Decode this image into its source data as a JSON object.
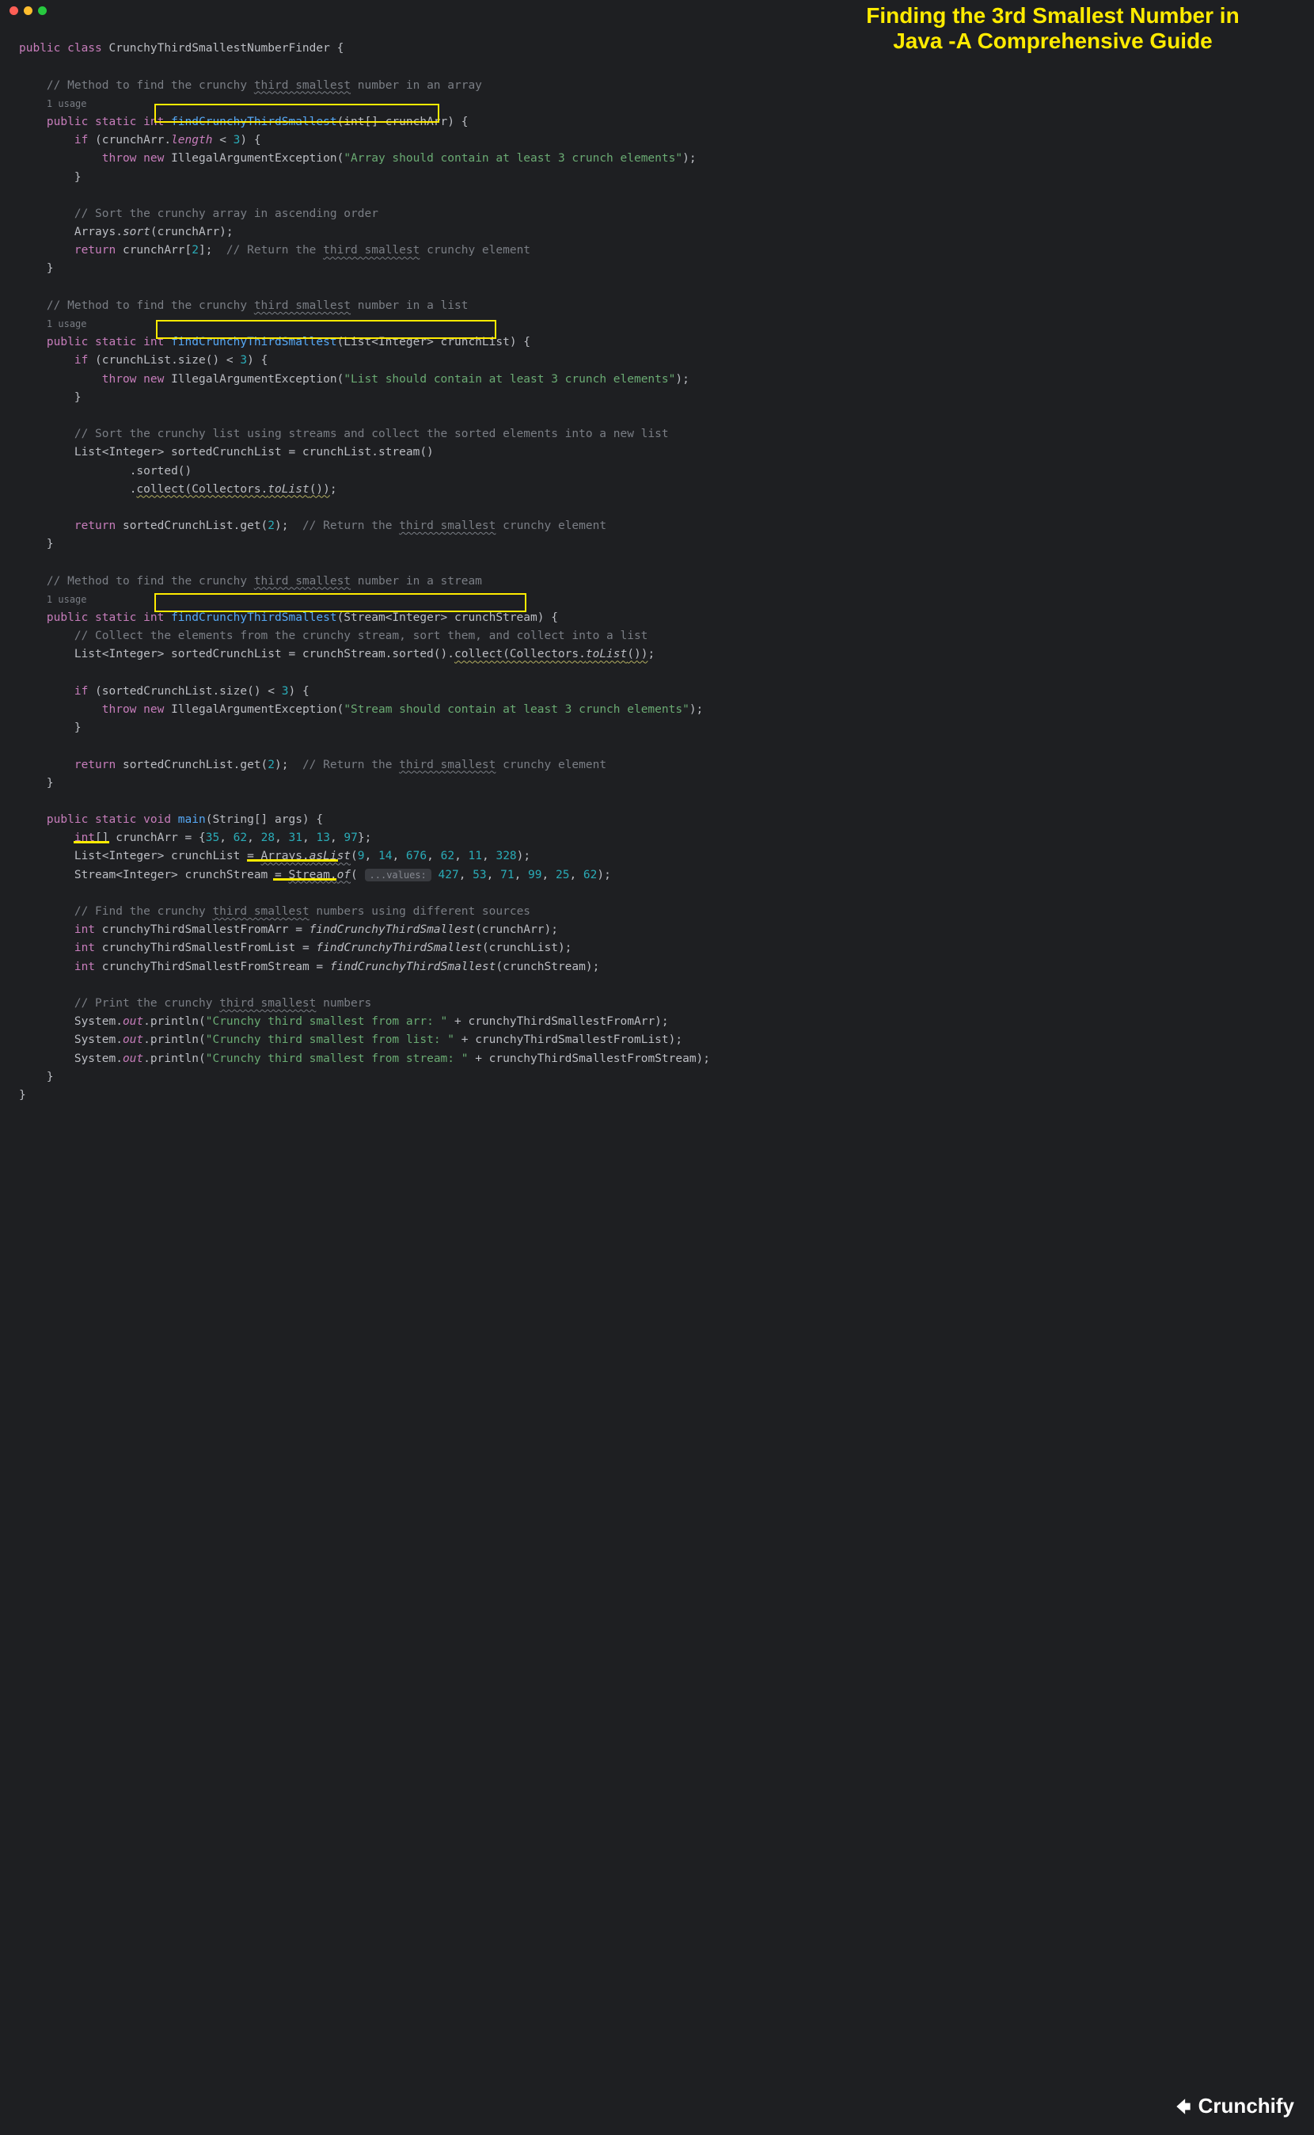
{
  "heading": {
    "line1": "Finding the 3rd Smallest Number in",
    "line2": "Java -A Comprehensive Guide"
  },
  "class": {
    "modifiers": "public class",
    "name": "CrunchyThirdSmallestNumberFinder",
    "open": "{"
  },
  "method1": {
    "comment": "// Method to find the crunchy third smallest number in an array",
    "commentPrefix": "// Method to find the crunchy ",
    "commentWavy": "third smallest",
    "commentSuffix": " number in an array",
    "usage": "1 usage",
    "sig_mods": "public static int",
    "sig_name": "findCrunchyThirdSmallest",
    "sig_params": "(int[] crunchArr) {",
    "if_open": "if (crunchArr.",
    "if_len": "length",
    "if_op": " < ",
    "if_num": "3",
    "if_close": ") {",
    "throw_kw": "throw new",
    "throw_cls": "IllegalArgumentException",
    "throw_open": "(",
    "throw_str": "\"Array should contain at least 3 crunch elements\"",
    "throw_close": ");",
    "close_brace": "}",
    "sort_comment": "// Sort the crunchy array in ascending order",
    "sort_call": "Arrays.",
    "sort_method": "sort",
    "sort_args": "(crunchArr);",
    "return_kw": "return",
    "return_expr": " crunchArr[",
    "return_idx": "2",
    "return_close": "];  ",
    "return_commentPrefix": "// Return the ",
    "return_commentWavy": "third smallest",
    "return_commentSuffix": " crunchy element"
  },
  "method2": {
    "commentPrefix": "// Method to find the crunchy ",
    "commentWavy": "third smallest",
    "commentSuffix": " number in a list",
    "usage": "1 usage",
    "sig_mods": "public static int",
    "sig_name": "findCrunchyThirdSmallest",
    "sig_params": "(List<Integer> crunchList) {",
    "if_line": "if (crunchList.size() < ",
    "if_num": "3",
    "if_close": ") {",
    "throw_kw": "throw new",
    "throw_cls": "IllegalArgumentException",
    "throw_str": "\"List should contain at least 3 crunch elements\"",
    "throw_close": ");",
    "sort_comment": "// Sort the crunchy list using streams and collect the sorted elements into a new list",
    "list_decl": "List<Integer> sortedCrunchList = crunchList.stream()",
    "sorted_call": ".sorted()",
    "collect_call": ".",
    "collect_wavy": "collect(Collectors.",
    "collect_toList": "toList",
    "collect_close": "())",
    "collect_semi": ";",
    "return_kw": "return",
    "return_expr": " sortedCrunchList.get(",
    "return_idx": "2",
    "return_close": ");  ",
    "return_commentPrefix": "// Return the ",
    "return_commentWavy": "third smallest",
    "return_commentSuffix": " crunchy element"
  },
  "method3": {
    "commentPrefix": "// Method to find the crunchy ",
    "commentWavy": "third smallest",
    "commentSuffix": " number in a stream",
    "usage": "1 usage",
    "sig_mods": "public static int",
    "sig_name": "findCrunchyThirdSmallest",
    "sig_params": "(Stream<Integer> crunchStream) {",
    "collect_comment": "// Collect the elements from the crunchy stream, sort them, and collect into a list",
    "list_decl": "List<Integer> sortedCrunchList = crunchStream.sorted().",
    "collect_wavy": "collect(Collectors.",
    "collect_toList": "toList",
    "collect_close": "())",
    "collect_semi": ";",
    "if_line": "if (sortedCrunchList.size() < ",
    "if_num": "3",
    "if_close": ") {",
    "throw_kw": "throw new",
    "throw_cls": "IllegalArgumentException",
    "throw_str": "\"Stream should contain at least 3 crunch elements\"",
    "throw_close": ");",
    "return_kw": "return",
    "return_expr": " sortedCrunchList.get(",
    "return_idx": "2",
    "return_close": ");  ",
    "return_commentPrefix": "// Return the ",
    "return_commentWavy": "third smallest",
    "return_commentSuffix": " crunchy element"
  },
  "mainMethod": {
    "sig_mods": "public static void",
    "sig_name": "main",
    "sig_params": "(String[] args) {",
    "arr_decl_type": "int",
    "arr_decl_rest": "[] crunchArr = {",
    "arr_vals": [
      "35",
      "62",
      "28",
      "31",
      "13",
      "97"
    ],
    "arr_close": "};",
    "list_decl": "List<Integer> crunchList = ",
    "list_arrays": "Arrays.",
    "list_asList": "asList",
    "list_open": "(",
    "list_vals": [
      "9",
      "14",
      "676",
      "62",
      "11",
      "328"
    ],
    "list_close": ");",
    "stream_decl": "Stream<Integer> crunchStream = ",
    "stream_cls": "Stream.",
    "stream_of": "of",
    "stream_open": "(",
    "stream_hint": "...values:",
    "stream_vals": [
      "427",
      "53",
      "71",
      "99",
      "25",
      "62"
    ],
    "stream_close": ");",
    "find_commentPrefix": "// Find the crunchy ",
    "find_commentWavy": "third smallest",
    "find_commentSuffix": " numbers using different sources",
    "var1": "int crunchyThirdSmallestFromArr = ",
    "call1": "findCrunchyThirdSmallest",
    "args1": "(crunchArr);",
    "var2": "int crunchyThirdSmallestFromList = ",
    "call2": "findCrunchyThirdSmallest",
    "args2": "(crunchList);",
    "var3": "int crunchyThirdSmallestFromStream = ",
    "call3": "findCrunchyThirdSmallest",
    "args3": "(crunchStream);",
    "print_commentPrefix": "// Print the crunchy ",
    "print_commentWavy": "third smallest",
    "print_commentSuffix": " numbers",
    "sys": "System.",
    "out": "out",
    "println": ".println(",
    "pstr1": "\"Crunchy third smallest from arr: \"",
    "pvar1": " + crunchyThirdSmallestFromArr);",
    "pstr2": "\"Crunchy third smallest from list: \"",
    "pvar2": " + crunchyThirdSmallestFromList);",
    "pstr3": "\"Crunchy third smallest from stream: \"",
    "pvar3": " + crunchyThirdSmallestFromStream);"
  },
  "watermark": "Crunchify"
}
